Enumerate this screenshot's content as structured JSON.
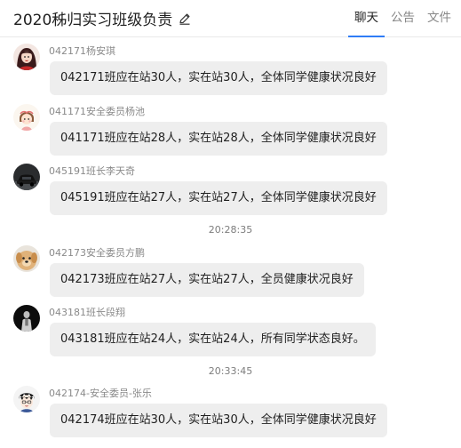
{
  "header": {
    "title": "2020秭归实习班级负责",
    "tabs": [
      {
        "label": "聊天",
        "active": true
      },
      {
        "label": "公告",
        "active": false
      },
      {
        "label": "文件",
        "active": false
      }
    ]
  },
  "colors": {
    "accent": "#2f7cf6",
    "bubble": "#eeeeee",
    "meta_text": "#8a8a8a"
  },
  "messages": [
    {
      "sender": "042171杨安琪",
      "text": "042171班应在站30人，实在站30人，全体同学健康状况良好",
      "avatar": "avatar-girl-red"
    },
    {
      "sender": "041171安全委员杨池",
      "text": "041171班应在站28人，实在站28人，全体同学健康状况良好",
      "avatar": "avatar-cartoon-girl"
    },
    {
      "sender": "045191班长李天奇",
      "text": "045191班应在站27人，实在站27人，全体同学健康状况良好",
      "avatar": "avatar-dark-car"
    },
    {
      "sender": "042173安全委员方鹏",
      "text": "042173班应在站27人，实在站27人，全员健康状况良好",
      "avatar": "avatar-dog"
    },
    {
      "sender": "043181班长段翔",
      "text": "043181班应在站24人，实在站24人，所有同学状态良好。",
      "avatar": "avatar-dark-figure"
    },
    {
      "sender": "042174-安全委员-张乐",
      "text": "042174班应在站30人，实在站30人，全体同学健康状况良好",
      "avatar": "avatar-anime-boy"
    }
  ],
  "timestamps": [
    "20:28:35",
    "20:33:45"
  ]
}
